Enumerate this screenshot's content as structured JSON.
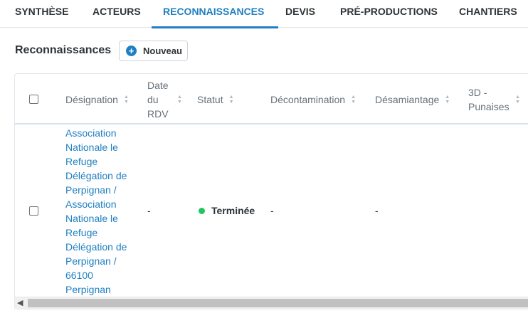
{
  "tabs": [
    {
      "label": "SYNTHÈSE"
    },
    {
      "label": "ACTEURS"
    },
    {
      "label": "RECONNAISSANCES",
      "active": true
    },
    {
      "label": "DEVIS"
    },
    {
      "label": "PRÉ-PRODUCTIONS"
    },
    {
      "label": "CHANTIERS"
    }
  ],
  "section": {
    "title": "Reconnaissances",
    "new_button": "Nouveau"
  },
  "table": {
    "columns": [
      "Désignation",
      "Date du RDV",
      "Statut",
      "Décontamination",
      "Désamiantage",
      "3D - Punaises"
    ],
    "rows": [
      {
        "designation_lines": [
          "Association",
          "Nationale le",
          "Refuge",
          "Délégation de",
          "Perpignan /",
          "Association",
          "Nationale le",
          "Refuge",
          "Délégation de",
          "Perpignan /",
          "66100",
          "Perpignan"
        ],
        "date_rdv": "-",
        "statut": "Terminée",
        "decontamination": "-",
        "desamiantage": "-",
        "punaises": ""
      }
    ]
  },
  "colors": {
    "accent": "#1f7fc1",
    "status_done": "#22c55e"
  }
}
